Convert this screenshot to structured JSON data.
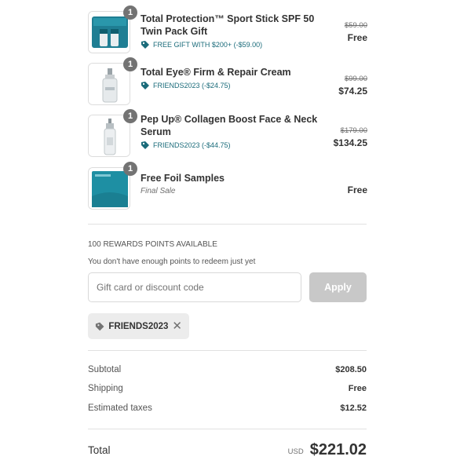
{
  "items": [
    {
      "quantity": "1",
      "name": "Total Protection™ Sport Stick SPF 50 Twin Pack Gift",
      "discount": "FREE GIFT WITH $200+ (-$59.00)",
      "original_price": "$59.00",
      "price": "Free",
      "image": "twin-pack-gift-image"
    },
    {
      "quantity": "1",
      "name": "Total Eye® Firm & Repair Cream",
      "discount": "FRIENDS2023 (-$24.75)",
      "original_price": "$99.00",
      "price": "$74.25",
      "image": "eye-cream-bottle-image"
    },
    {
      "quantity": "1",
      "name": "Pep Up® Collagen Boost Face & Neck Serum",
      "discount": "FRIENDS2023 (-$44.75)",
      "original_price": "$179.00",
      "price": "$134.25",
      "image": "serum-bottle-image"
    },
    {
      "quantity": "1",
      "name": "Free Foil Samples",
      "note": "Final Sale",
      "price": "Free",
      "image": "foil-samples-image"
    }
  ],
  "rewards": {
    "title": "100 REWARDS POINTS AVAILABLE",
    "note": "You don't have enough points to redeem just yet"
  },
  "discount_form": {
    "placeholder": "Gift card or discount code",
    "apply_label": "Apply"
  },
  "applied_code": {
    "label": "FRIENDS2023",
    "remove": "✕"
  },
  "summary": {
    "subtotal_label": "Subtotal",
    "subtotal_value": "$208.50",
    "shipping_label": "Shipping",
    "shipping_value": "Free",
    "taxes_label": "Estimated taxes",
    "taxes_value": "$12.52",
    "total_label": "Total",
    "currency": "USD",
    "total_value": "$221.02"
  },
  "colors": {
    "accent_teal": "#1a6b7a",
    "badge": "#737373",
    "apply_disabled": "#c8c8c8"
  }
}
